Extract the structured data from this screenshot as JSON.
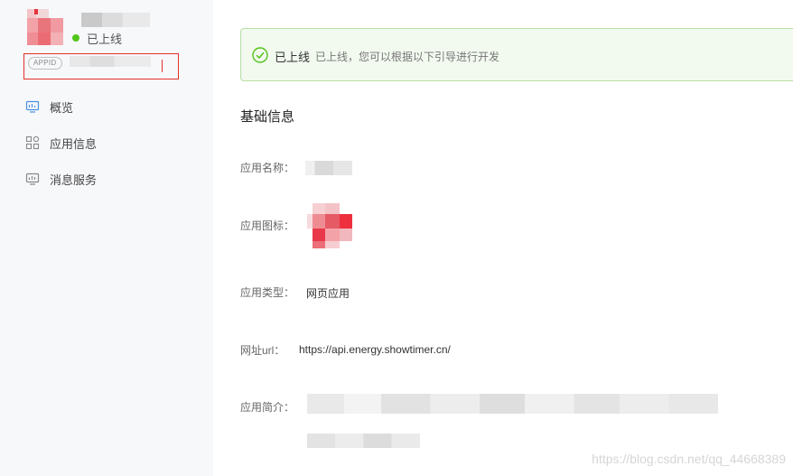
{
  "sidebar": {
    "status_text": "已上线",
    "status_color": "#52c41a",
    "appid_tag": "APPID",
    "nav": [
      {
        "label": "概览",
        "icon": "monitor-icon"
      },
      {
        "label": "应用信息",
        "icon": "grid-icon"
      },
      {
        "label": "消息服务",
        "icon": "chart-monitor-icon"
      }
    ]
  },
  "banner": {
    "title": "已上线",
    "description": "已上线，您可以根据以下引导进行开发",
    "icon": "check-circle-icon",
    "accent_color": "#52c41a"
  },
  "basic_info": {
    "title": "基础信息",
    "fields": {
      "app_name": {
        "label": "应用名称："
      },
      "app_icon": {
        "label": "应用图标："
      },
      "app_type": {
        "label": "应用类型：",
        "value": "网页应用"
      },
      "url": {
        "label": "网址url：",
        "value": "https://api.energy.showtimer.cn/"
      },
      "intro": {
        "label": "应用简介："
      }
    }
  },
  "watermark": "https://blog.csdn.net/qq_44668389"
}
